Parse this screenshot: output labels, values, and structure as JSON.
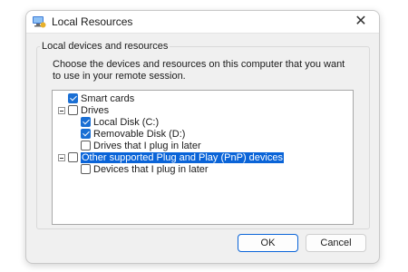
{
  "window": {
    "title": "Local Resources",
    "close_glyph": "✕",
    "icon": "monitor-icon"
  },
  "group": {
    "label": "Local devices and resources",
    "description": "Choose the devices and resources on this computer that you want to use in your remote session."
  },
  "tree": {
    "items": [
      {
        "label": "Smart cards",
        "checked": true,
        "selected": false
      },
      {
        "label": "Drives",
        "checked": false,
        "expander": "minus"
      },
      {
        "label": "Local Disk (C:)",
        "checked": true
      },
      {
        "label": "Removable Disk (D:)",
        "checked": true
      },
      {
        "label": "Drives that I plug in later",
        "checked": false
      },
      {
        "label": "Other supported Plug and Play (PnP) devices",
        "checked": false,
        "selected": true,
        "expander": "minus"
      },
      {
        "label": "Devices that I plug in later",
        "checked": false
      }
    ]
  },
  "buttons": {
    "ok": "OK",
    "cancel": "Cancel"
  },
  "colors": {
    "accent": "#1a6fd4",
    "selection": "#0a64d8"
  }
}
